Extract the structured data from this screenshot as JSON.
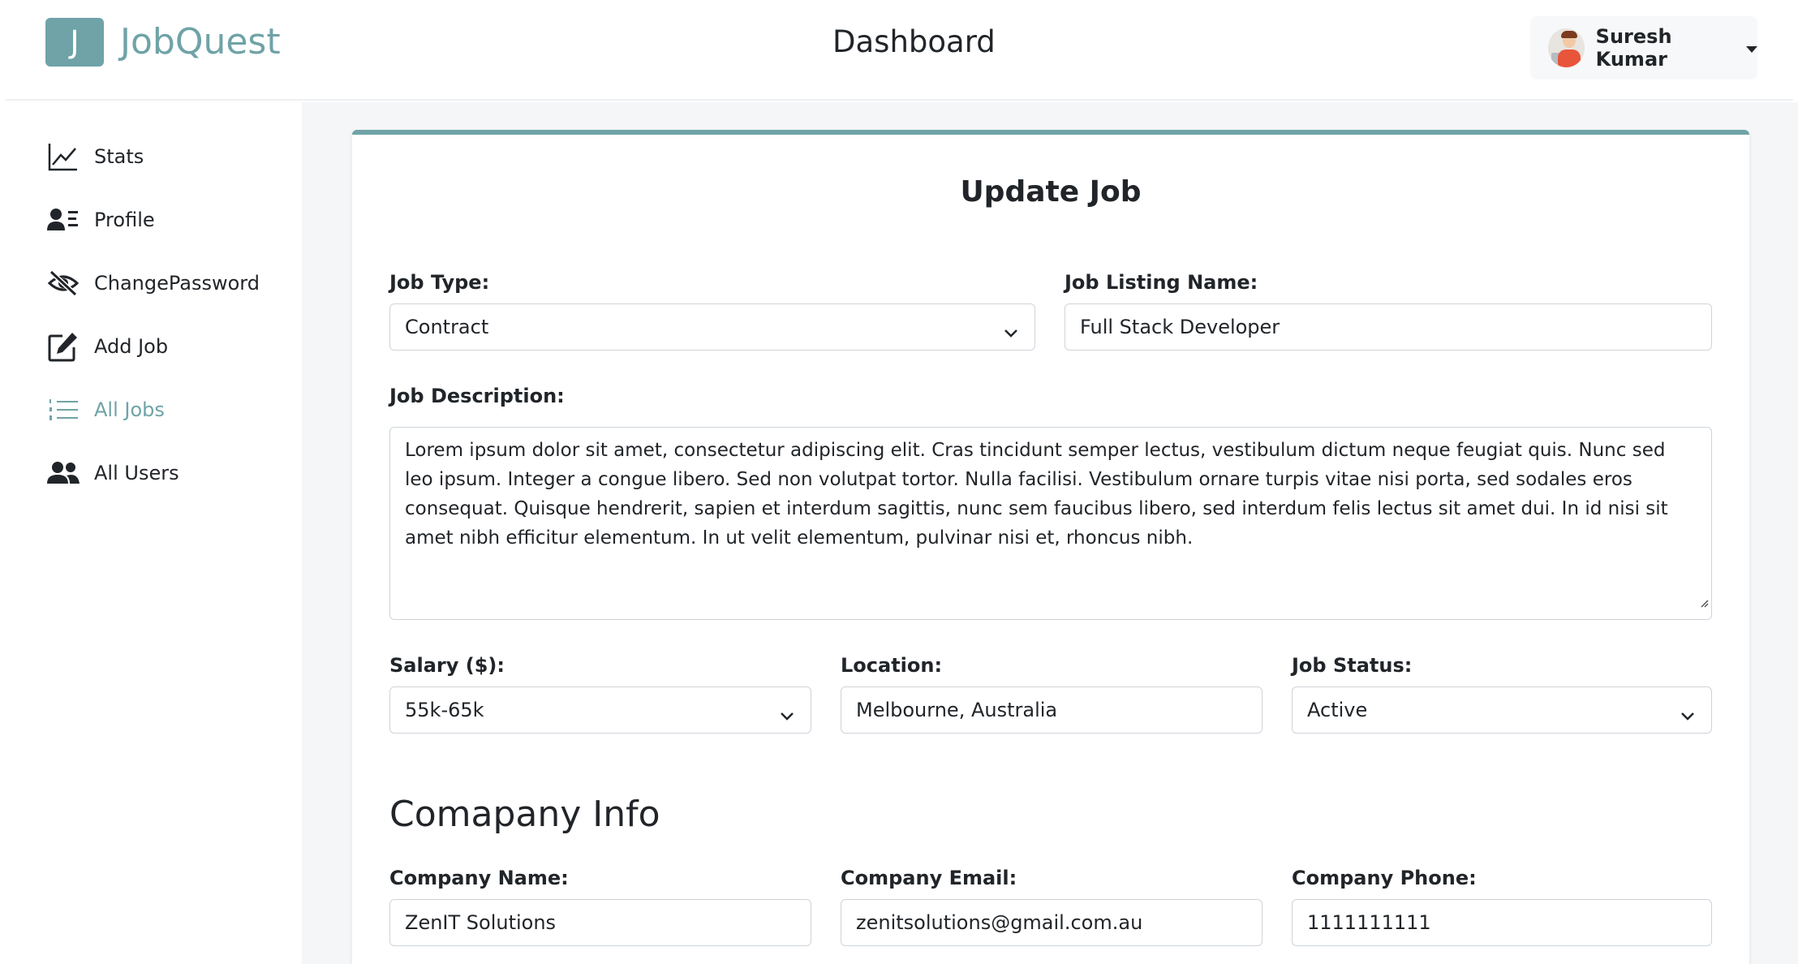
{
  "app": {
    "logo_letter": "J",
    "name": "JobQuest"
  },
  "header": {
    "title": "Dashboard",
    "user_name": "Suresh Kumar"
  },
  "sidebar": {
    "items": [
      {
        "label": "Stats",
        "icon": "chart-line-icon"
      },
      {
        "label": "Profile",
        "icon": "profile-card-icon"
      },
      {
        "label": "ChangePassword",
        "icon": "eye-slash-icon"
      },
      {
        "label": "Add Job",
        "icon": "edit-square-icon"
      },
      {
        "label": "All Jobs",
        "icon": "list-icon"
      },
      {
        "label": "All Users",
        "icon": "users-icon"
      }
    ],
    "active": "All Jobs"
  },
  "form": {
    "title": "Update Job",
    "job_type": {
      "label": "Job Type:",
      "value": "Contract"
    },
    "job_listing_name": {
      "label": "Job Listing Name:",
      "value": "Full Stack Developer"
    },
    "job_description": {
      "label": "Job Description:",
      "value": "Lorem ipsum dolor sit amet, consectetur adipiscing elit. Cras tincidunt semper lectus, vestibulum dictum neque feugiat quis. Nunc sed leo ipsum. Integer a congue libero. Sed non volutpat tortor. Nulla facilisi. Vestibulum ornare turpis vitae nisi porta, sed sodales eros consequat. Quisque hendrerit, sapien et interdum sagittis, nunc sem faucibus libero, sed interdum felis lectus sit amet dui. In id nisi sit amet nibh efficitur elementum. In ut velit elementum, pulvinar nisi et, rhoncus nibh."
    },
    "salary": {
      "label": "Salary ($):",
      "value": "55k-65k"
    },
    "location": {
      "label": "Location:",
      "value": "Melbourne, Australia"
    },
    "job_status": {
      "label": "Job Status:",
      "value": "Active"
    },
    "company_section_title": "Comapany Info",
    "company_name": {
      "label": "Company Name:",
      "value": "ZenIT Solutions"
    },
    "company_email": {
      "label": "Company Email:",
      "value": "zenitsolutions@gmail.com.au"
    },
    "company_phone": {
      "label": "Company Phone:",
      "value": "1111111111"
    }
  },
  "colors": {
    "accent": "#6fa3a7",
    "text": "#212529",
    "border": "#ced4da",
    "main_bg": "#f5f6f8"
  }
}
